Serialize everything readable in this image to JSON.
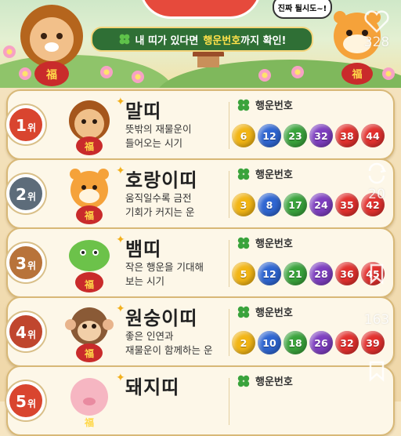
{
  "header": {
    "banner_prefix": "내 띠가 있다면",
    "banner_highlight": "행운번호",
    "banner_suffix": "까지 확인!",
    "bubble": "진짜 될시도~!",
    "fu": "福"
  },
  "lucky_label": "행운번호",
  "rank_unit": "위",
  "rankings": [
    {
      "rank": "1",
      "sign": "말띠",
      "desc": [
        "뜻밖의 재물운이",
        "들어오는 시기"
      ],
      "numbers": [
        "6",
        "12",
        "23",
        "32",
        "38",
        "44"
      ],
      "badge_color": "#d9452f"
    },
    {
      "rank": "2",
      "sign": "호랑이띠",
      "desc": [
        "움직일수록 금전",
        "기회가 커지는 운"
      ],
      "numbers": [
        "3",
        "8",
        "17",
        "24",
        "35",
        "42"
      ],
      "badge_color": "#5d6c7a"
    },
    {
      "rank": "3",
      "sign": "뱀띠",
      "desc": [
        "작은 행운을 기대해",
        "보는 시기"
      ],
      "numbers": [
        "5",
        "12",
        "21",
        "28",
        "36",
        "45"
      ],
      "badge_color": "#b8733a"
    },
    {
      "rank": "4",
      "sign": "원숭이띠",
      "desc": [
        "좋은 인연과",
        "재물운이 함께하는 운"
      ],
      "numbers": [
        "2",
        "10",
        "18",
        "26",
        "32",
        "39"
      ],
      "badge_color": "#c0462e"
    },
    {
      "rank": "5",
      "sign": "돼지띠",
      "desc": [
        "",
        ""
      ],
      "numbers": [],
      "badge_color": "#d9452f"
    }
  ],
  "ball_colors": {
    "yellow": "#f2b515",
    "blue": "#2f66d2",
    "red": "#e2312e",
    "purple": "#7e3fc0",
    "green": "#3aa33c"
  },
  "overlay": {
    "likes": "328",
    "shares": "20",
    "comments": "163"
  }
}
